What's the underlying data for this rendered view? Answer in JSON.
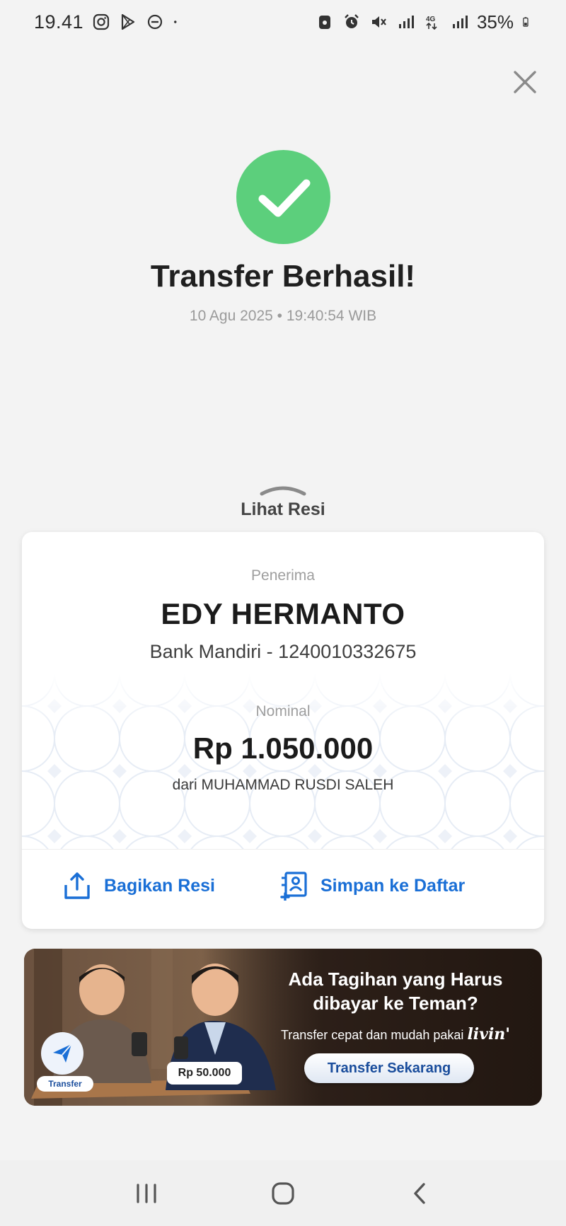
{
  "status_bar": {
    "time": "19.41",
    "battery": "35%",
    "icons": [
      "instagram-icon",
      "play-store-icon",
      "dnd-icon",
      "dot-icon",
      "app-icon",
      "alarm-icon",
      "mute-icon",
      "signal-icon",
      "4g-icon",
      "signal-icon",
      "battery-icon"
    ]
  },
  "header": {
    "title": "Transfer Berhasil!",
    "timestamp": "10 Agu 2025 • 19:40:54 WIB",
    "success_color": "#5ccf7c"
  },
  "resi": {
    "label": "Lihat Resi"
  },
  "receipt": {
    "recipient_label": "Penerima",
    "recipient_name": "EDY HERMANTO",
    "recipient_bank": "Bank Mandiri - 1240010332675",
    "amount_label": "Nominal",
    "amount": "Rp 1.050.000",
    "sender": "dari MUHAMMAD RUSDI SALEH",
    "actions": {
      "share_label": "Bagikan Resi",
      "save_label": "Simpan ke Daftar"
    },
    "accent_color": "#1a6fd6"
  },
  "banner": {
    "headline_line1": "Ada Tagihan yang Harus",
    "headline_line2": "dibayar ke Teman?",
    "sub_text": "Transfer cepat dan mudah pakai",
    "brand": "livin'",
    "cta_label": "Transfer Sekarang",
    "transfer_tag": "Transfer",
    "amount_tag": "Rp 50.000"
  },
  "nav": {
    "icons": [
      "recents-icon",
      "home-icon",
      "back-icon"
    ]
  }
}
